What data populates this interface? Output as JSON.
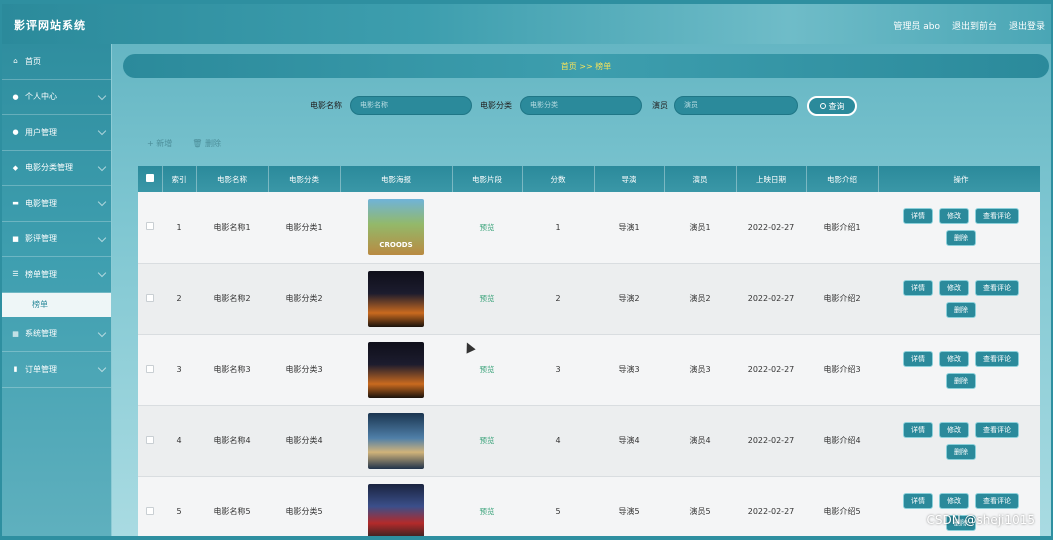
{
  "app": {
    "title": "影评网站系统",
    "admin_label": "管理员 abo",
    "exit_to_front": "退出到前台",
    "logout": "退出登录",
    "watermark": "CSDN @sheji1015"
  },
  "sidebar": {
    "items": [
      {
        "label": "首页",
        "icon": "home-icon"
      },
      {
        "label": "个人中心",
        "icon": "user-icon"
      },
      {
        "label": "用户管理",
        "icon": "user-icon"
      },
      {
        "label": "电影分类管理",
        "icon": "location-pin-icon"
      },
      {
        "label": "电影管理",
        "icon": "film-icon"
      },
      {
        "label": "影评管理",
        "icon": "comment-icon"
      },
      {
        "label": "榜单管理",
        "icon": "list-icon"
      },
      {
        "label": "系统管理",
        "icon": "grid-icon"
      },
      {
        "label": "订单管理",
        "icon": "bar-chart-icon"
      }
    ],
    "submenu": {
      "label": "榜单"
    }
  },
  "breadcrumb": {
    "text": "首页 >> 榜单"
  },
  "search": {
    "name_label": "电影名称",
    "name_placeholder": "电影名称",
    "category_label": "电影分类",
    "category_placeholder": "电影分类",
    "actor_label": "演员",
    "actor_placeholder": "演员",
    "button_label": "查询"
  },
  "toolbar": {
    "add_label": "+ 新增",
    "delete_label": "🗑 删除"
  },
  "table": {
    "headers": [
      "索引",
      "电影名称",
      "电影分类",
      "电影海报",
      "电影片段",
      "分数",
      "导演",
      "演员",
      "上映日期",
      "电影介绍",
      "操作"
    ],
    "rows": [
      {
        "index": "1",
        "name": "电影名称1",
        "category": "电影分类1",
        "poster_title": "CROODS",
        "trailer": "预览",
        "score": "1",
        "director": "导演1",
        "actor": "演员1",
        "date": "2022-02-27",
        "intro": "电影介绍1"
      },
      {
        "index": "2",
        "name": "电影名称2",
        "category": "电影分类2",
        "poster_title": "",
        "trailer": "预览",
        "score": "2",
        "director": "导演2",
        "actor": "演员2",
        "date": "2022-02-27",
        "intro": "电影介绍2"
      },
      {
        "index": "3",
        "name": "电影名称3",
        "category": "电影分类3",
        "poster_title": "",
        "trailer": "预览",
        "score": "3",
        "director": "导演3",
        "actor": "演员3",
        "date": "2022-02-27",
        "intro": "电影介绍3"
      },
      {
        "index": "4",
        "name": "电影名称4",
        "category": "电影分类4",
        "poster_title": "",
        "trailer": "预览",
        "score": "4",
        "director": "导演4",
        "actor": "演员4",
        "date": "2022-02-27",
        "intro": "电影介绍4"
      },
      {
        "index": "5",
        "name": "电影名称5",
        "category": "电影分类5",
        "poster_title": "",
        "trailer": "预览",
        "score": "5",
        "director": "导演5",
        "actor": "演员5",
        "date": "2022-02-27",
        "intro": "电影介绍5"
      }
    ],
    "op_labels": {
      "detail": "详情",
      "edit": "修改",
      "reviews": "查看评论",
      "delete": "删除"
    }
  }
}
